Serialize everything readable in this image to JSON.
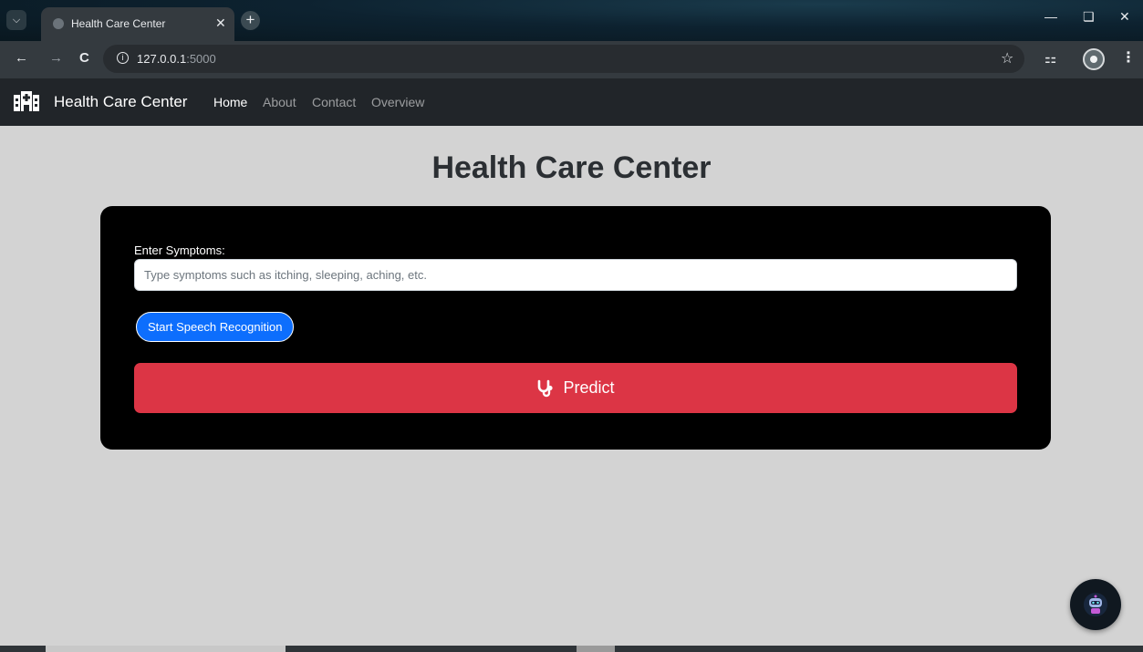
{
  "browser": {
    "tab_title": "Health Care Center",
    "url_host": "127.0.0.1",
    "url_port": ":5000"
  },
  "navbar": {
    "brand": "Health Care Center",
    "links": [
      {
        "label": "Home",
        "active": true
      },
      {
        "label": "About",
        "active": false
      },
      {
        "label": "Contact",
        "active": false
      },
      {
        "label": "Overview",
        "active": false
      }
    ]
  },
  "main": {
    "title": "Health Care Center",
    "symptoms_label": "Enter Symptoms:",
    "symptoms_placeholder": "Type symptoms such as itching, sleeping, aching, etc.",
    "speech_button": "Start Speech Recognition",
    "predict_button": "Predict"
  },
  "colors": {
    "page_bg": "#d3d3d3",
    "navbar_bg": "#212529",
    "card_bg": "#000000",
    "speech_btn": "#0d6efd",
    "predict_btn": "#dc3545"
  },
  "icons": {
    "brand": "hospital-icon",
    "predict": "stethoscope-icon",
    "chatbot": "robot-icon"
  }
}
